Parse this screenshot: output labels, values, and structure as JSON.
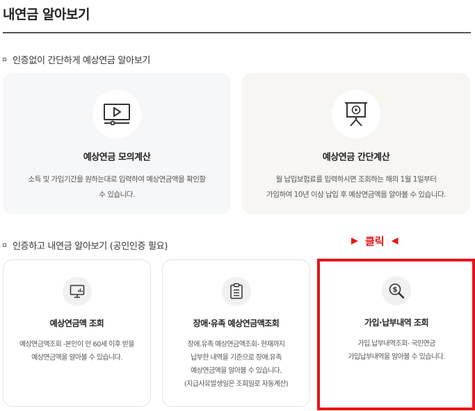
{
  "header": {
    "title": "내연금 알아보기"
  },
  "section1": {
    "heading": "인증없이 간단하게 예상연금 알아보기",
    "cards": [
      {
        "icon": "video-player-icon",
        "title": "예상연금 모의계산",
        "desc_line1": "소득 및 가입기간을 원하는대로 입력하여 예상연금액을 확인할",
        "desc_line2": "수 있습니다."
      },
      {
        "icon": "presentation-board-icon",
        "title": "예상연금 간단계산",
        "desc_line1": "월 납입보험료를 입력하시면 조회하는 해의 1월 1일부터",
        "desc_line2": "가입하여 10년 이상 납입 후 예상연금액을 알아볼 수 있습니다."
      }
    ]
  },
  "section2": {
    "heading": "인증하고 내연금 알아보기 (공인인증 필요)",
    "cards": [
      {
        "icon": "monitor-chart-icon",
        "title": "예상연금액 조회",
        "desc_line1": "예상연금액조회 -본인이 만 60세 이후 받을",
        "desc_line2": "예상연금액을 알아볼 수 있습니다."
      },
      {
        "icon": "clipboard-icon",
        "title": "장애·유족 예상연금액조회",
        "desc_line1": "장애.유족 예상연금액조회- 현재까지",
        "desc_line2": "납부한 내역을 기준으로 장애.유족",
        "desc_line3": "예상연금액을 알아볼 수 있습니다.",
        "desc_line4": "(지급사유발생일은 조회일로 자동계산)"
      },
      {
        "icon": "magnifier-dollar-icon",
        "title": "가입·납부내역 조회",
        "desc_line1": "가입.납부내역조회- 국민연금",
        "desc_line2": "가입납부내역을 알아볼 수 있습니다."
      }
    ]
  },
  "annotation": {
    "label": "클릭",
    "left_arrow": "▶",
    "right_arrow": "◀",
    "color": "#e8141a"
  }
}
